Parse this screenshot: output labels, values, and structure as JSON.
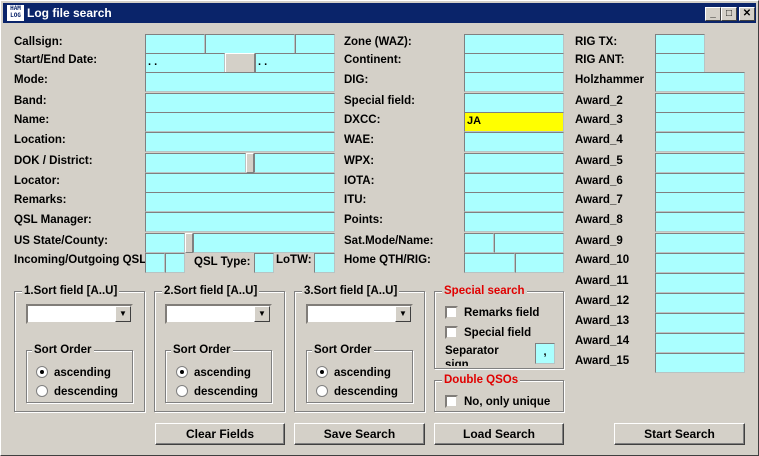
{
  "window": {
    "title": "Log file search",
    "icon_text": "HAM LOG"
  },
  "left_labels": {
    "callsign": "Callsign:",
    "dates": "Start/End Date:",
    "mode": "Mode:",
    "band": "Band:",
    "name": "Name:",
    "location": "Location:",
    "dok": "DOK / District:",
    "locator": "Locator:",
    "remarks": "Remarks:",
    "qsl_manager": "QSL Manager:",
    "us_state": "US State/County:",
    "incoming": "Incoming/Outgoing QSL:",
    "qsl_type": "QSL Type:",
    "lotw": "LoTW:"
  },
  "dates": {
    "start": " .  .",
    "end": " .  ."
  },
  "mid_labels": {
    "zone": "Zone (WAZ):",
    "continent": "Continent:",
    "dig": "DIG:",
    "special": "Special field:",
    "dxcc": "DXCC:",
    "wae": "WAE:",
    "wpx": "WPX:",
    "iota": "IOTA:",
    "itu": "ITU:",
    "points": "Points:",
    "sat": "Sat.Mode/Name:",
    "home": "Home QTH/RIG:"
  },
  "dxcc_value": "JA",
  "right_labels": [
    "RIG TX:",
    "RIG ANT:",
    "Holzhammer",
    "Award_2",
    "Award_3",
    "Award_4",
    "Award_5",
    "Award_6",
    "Award_7",
    "Award_8",
    "Award_9",
    "Award_10",
    "Award_11",
    "Award_12",
    "Award_13",
    "Award_14",
    "Award_15"
  ],
  "sort_groups": [
    {
      "title": "1.Sort field [A..U]"
    },
    {
      "title": "2.Sort field [A..U]"
    },
    {
      "title": "3.Sort field [A..U]"
    }
  ],
  "sort_order": {
    "title": "Sort Order",
    "ascending": "ascending",
    "descending": "descending"
  },
  "special_search": {
    "title": "Special search",
    "remarks_field": "Remarks field",
    "special_field": "Special field",
    "separator": "Separator sign",
    "separator_value": ","
  },
  "double_qsos": {
    "title": "Double QSOs",
    "only_unique": "No, only unique"
  },
  "buttons": {
    "clear": "Clear Fields",
    "save": "Save Search",
    "load": "Load Search",
    "start": "Start Search"
  }
}
